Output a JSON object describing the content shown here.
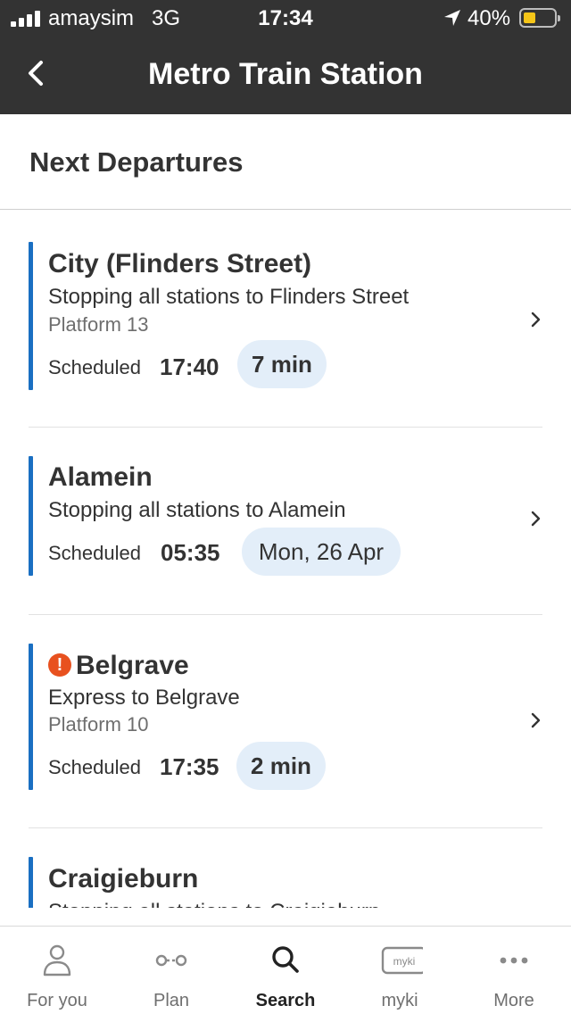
{
  "status_bar": {
    "carrier": "amaysim",
    "network": "3G",
    "time": "17:34",
    "battery": "40%",
    "battery_level": 0.4
  },
  "header": {
    "title": "Metro Train Station",
    "back_icon": "chevron-left-icon"
  },
  "section": {
    "title": "Next Departures"
  },
  "departures": [
    {
      "destination": "City (Flinders Street)",
      "description": "Stopping all stations to Flinders Street",
      "platform": "Platform 13",
      "scheduled_label": "Scheduled",
      "scheduled_time": "17:40",
      "countdown": "7 min",
      "alert": false
    },
    {
      "destination": "Alamein",
      "description": "Stopping all stations to Alamein",
      "platform": "",
      "scheduled_label": "Scheduled",
      "scheduled_time": "05:35",
      "countdown": "Mon, 26 Apr",
      "alert": false
    },
    {
      "destination": "Belgrave",
      "description": "Express to Belgrave",
      "platform": "Platform 10",
      "scheduled_label": "Scheduled",
      "scheduled_time": "17:35",
      "countdown": "2 min",
      "alert": true,
      "alert_symbol": "!"
    },
    {
      "destination": "Craigieburn",
      "description": "Stopping all stations to Craigieburn",
      "platform": "",
      "scheduled_label": "",
      "scheduled_time": "",
      "countdown": "",
      "alert": false
    }
  ],
  "tab_bar": {
    "tabs": [
      {
        "label": "For you",
        "icon": "person-icon",
        "active": false
      },
      {
        "label": "Plan",
        "icon": "route-icon",
        "active": false
      },
      {
        "label": "Search",
        "icon": "search-icon",
        "active": true
      },
      {
        "label": "myki",
        "icon": "myki-card-icon",
        "icon_text": "myki",
        "active": false
      },
      {
        "label": "More",
        "icon": "more-dots-icon",
        "active": false
      }
    ]
  },
  "colors": {
    "header_bg": "#333333",
    "accent_line": "#1a6fc2",
    "pill_bg": "#e3eef9",
    "alert": "#e8511f",
    "battery": "#f5c518"
  }
}
